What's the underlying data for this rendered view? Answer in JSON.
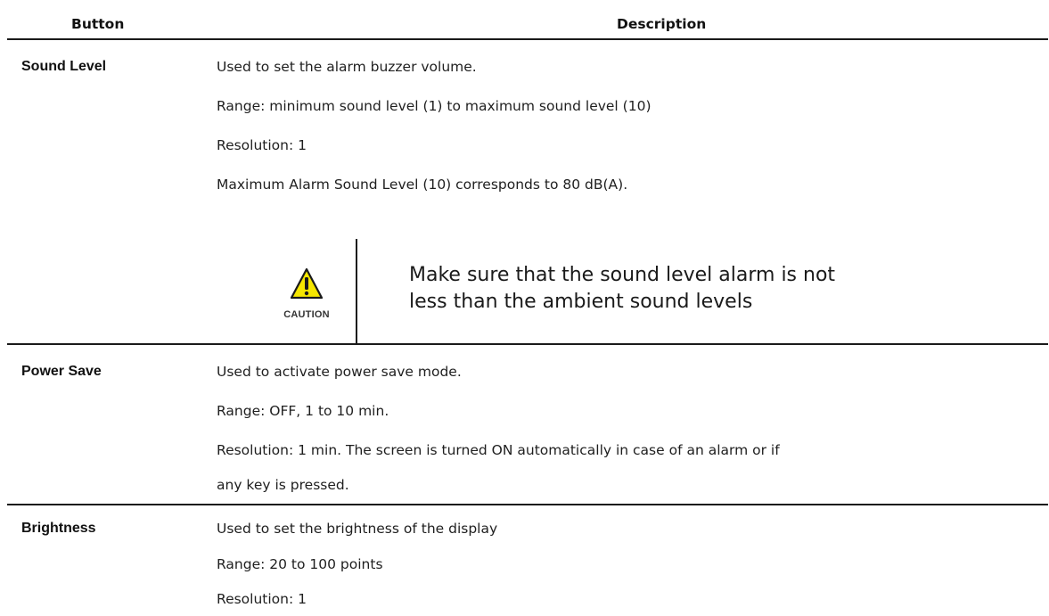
{
  "header": {
    "button_col": "Button",
    "description_col": "Description"
  },
  "rows": [
    {
      "label": "Sound Level",
      "lines": [
        "Used to set the alarm buzzer volume.",
        "Range: minimum sound level (1) to maximum sound level (10)",
        "Resolution: 1",
        "Maximum Alarm Sound Level (10) corresponds to 80 dB(A)."
      ],
      "caution": {
        "icon": "caution-warning-triangle",
        "label": "CAUTION",
        "lines": [
          "Make sure that the sound level alarm is not",
          "less than the ambient sound levels"
        ],
        "colors": {
          "triangle_fill": "#f5e600",
          "outline": "#1a1a1a"
        }
      }
    },
    {
      "label": "Power Save",
      "lines": [
        "Used to activate power save mode.",
        "Range: OFF, 1 to 10 min.",
        "Resolution: 1 min. The screen is turned ON automatically in case of an alarm or if",
        "any key is pressed."
      ]
    },
    {
      "label": "Brightness",
      "lines": [
        "Used to set the brightness of the display",
        "Range: 20 to 100 points",
        "Resolution: 1"
      ]
    }
  ]
}
